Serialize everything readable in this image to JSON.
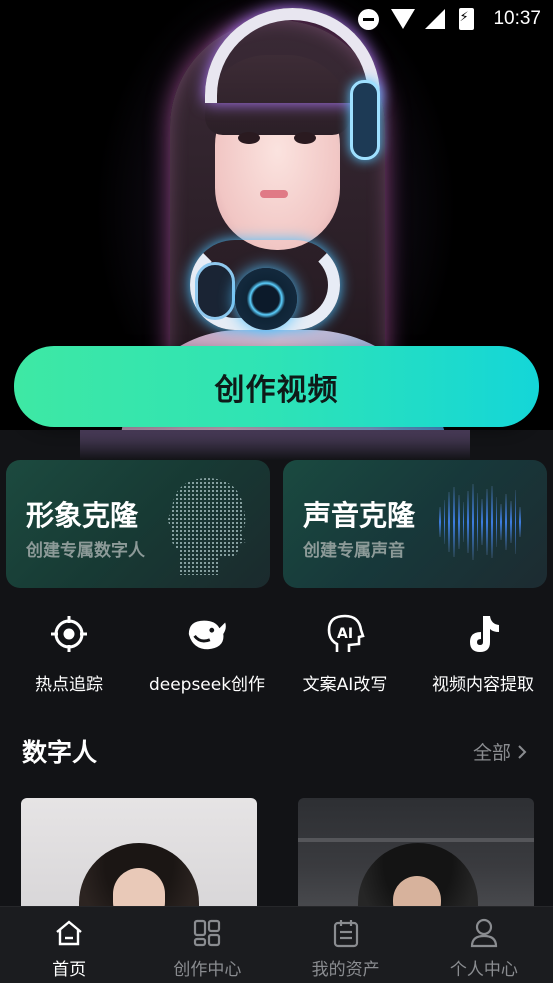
{
  "status_bar": {
    "time": "10:37"
  },
  "hero": {
    "create_button": "创作视频"
  },
  "clone_cards": [
    {
      "title": "形象克隆",
      "subtitle": "创建专属数字人"
    },
    {
      "title": "声音克隆",
      "subtitle": "创建专属声音"
    }
  ],
  "tools": [
    {
      "label": "热点追踪",
      "icon": "crosshair-icon"
    },
    {
      "label": "deepseek创作",
      "icon": "whale-icon"
    },
    {
      "label": "文案AI改写",
      "icon": "ai-head-icon"
    },
    {
      "label": "视频内容提取",
      "icon": "tiktok-icon"
    }
  ],
  "section": {
    "title": "数字人",
    "more": "全部"
  },
  "bottom_nav": [
    {
      "label": "首页",
      "active": true
    },
    {
      "label": "创作中心",
      "active": false
    },
    {
      "label": "我的资产",
      "active": false
    },
    {
      "label": "个人中心",
      "active": false
    }
  ],
  "colors": {
    "accent_start": "#3ee8a4",
    "accent_end": "#14d6d8",
    "background": "#121316"
  }
}
